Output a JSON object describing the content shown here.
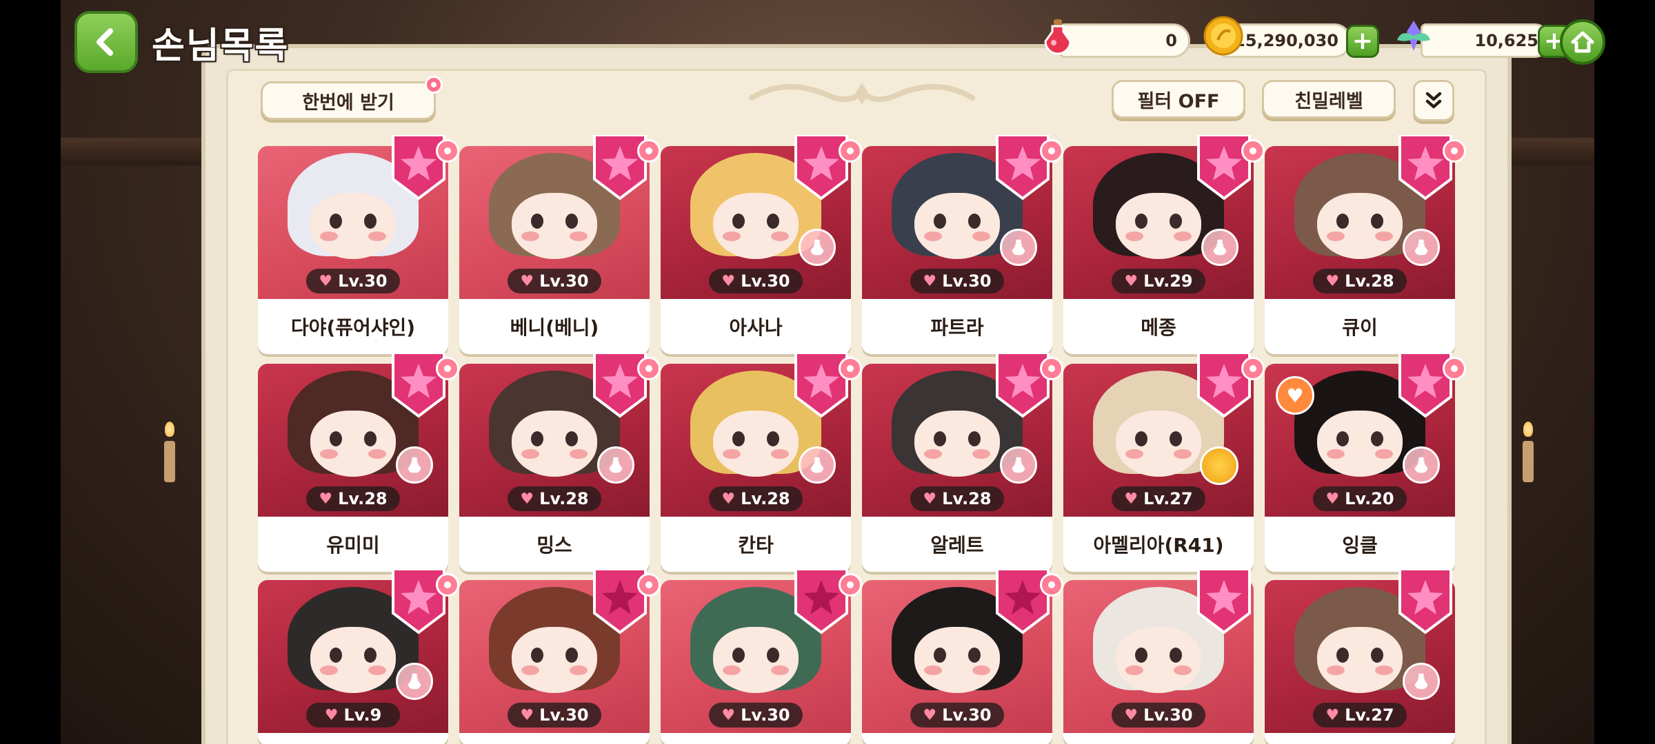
{
  "header": {
    "title": "손님목록",
    "resources": {
      "potion": "0",
      "gold": "15,290,030",
      "gem": "10,625"
    }
  },
  "actions": {
    "receive_all": "한번에 받기",
    "filter": "필터 OFF",
    "sort": "친밀레벨"
  },
  "colors": {
    "accent_green": "#5aa92c",
    "card_red": "#a8243a",
    "badge_pink": "#e0306a",
    "panel_bg": "#f4ecd9"
  },
  "guests": [
    {
      "name": "다야(퓨어샤인)",
      "level": "Lv.30",
      "hair": "#e9e9f2",
      "bg": "light",
      "badge": "none"
    },
    {
      "name": "베니(베니)",
      "level": "Lv.30",
      "hair": "#8a6a52",
      "bg": "light",
      "badge": "none"
    },
    {
      "name": "아사나",
      "level": "Lv.30",
      "hair": "#f0c36a",
      "bg": "dark",
      "badge": "bottle"
    },
    {
      "name": "파트라",
      "level": "Lv.30",
      "hair": "#3a3f4d",
      "bg": "dark",
      "badge": "bottle"
    },
    {
      "name": "메종",
      "level": "Lv.29",
      "hair": "#2a1c1c",
      "bg": "dark",
      "badge": "bottle"
    },
    {
      "name": "큐이",
      "level": "Lv.28",
      "hair": "#7b5a49",
      "bg": "dark",
      "badge": "bottle"
    },
    {
      "name": "유미미",
      "level": "Lv.28",
      "hair": "#4f2a25",
      "bg": "dark",
      "badge": "bottle"
    },
    {
      "name": "밍스",
      "level": "Lv.28",
      "hair": "#4a3530",
      "bg": "dark",
      "badge": "bottle"
    },
    {
      "name": "칸타",
      "level": "Lv.28",
      "hair": "#e9c060",
      "bg": "dark",
      "badge": "bottle"
    },
    {
      "name": "알레트",
      "level": "Lv.28",
      "hair": "#3a3434",
      "bg": "dark",
      "badge": "bottle"
    },
    {
      "name": "아멜리아(R41)",
      "level": "Lv.27",
      "hair": "#e6d2b4",
      "bg": "dark",
      "badge": "gold"
    },
    {
      "name": "잉클",
      "level": "Lv.20",
      "hair": "#1a1414",
      "bg": "dark",
      "badge": "bottle"
    },
    {
      "name": "",
      "level": "Lv.9",
      "hair": "#2f2a2a",
      "bg": "dark",
      "badge": "bottle"
    },
    {
      "name": "",
      "level": "Lv.30",
      "hair": "#7a3b2c",
      "bg": "light",
      "badge": "none"
    },
    {
      "name": "",
      "level": "Lv.30",
      "hair": "#3f6b55",
      "bg": "light",
      "badge": "none"
    },
    {
      "name": "",
      "level": "Lv.30",
      "hair": "#1f1a1a",
      "bg": "light",
      "badge": "none"
    },
    {
      "name": "",
      "level": "Lv.30",
      "hair": "#ece6e0",
      "bg": "light",
      "badge": "none"
    },
    {
      "name": "",
      "level": "Lv.27",
      "hair": "#7b5a49",
      "bg": "dark",
      "badge": "bottle"
    }
  ]
}
